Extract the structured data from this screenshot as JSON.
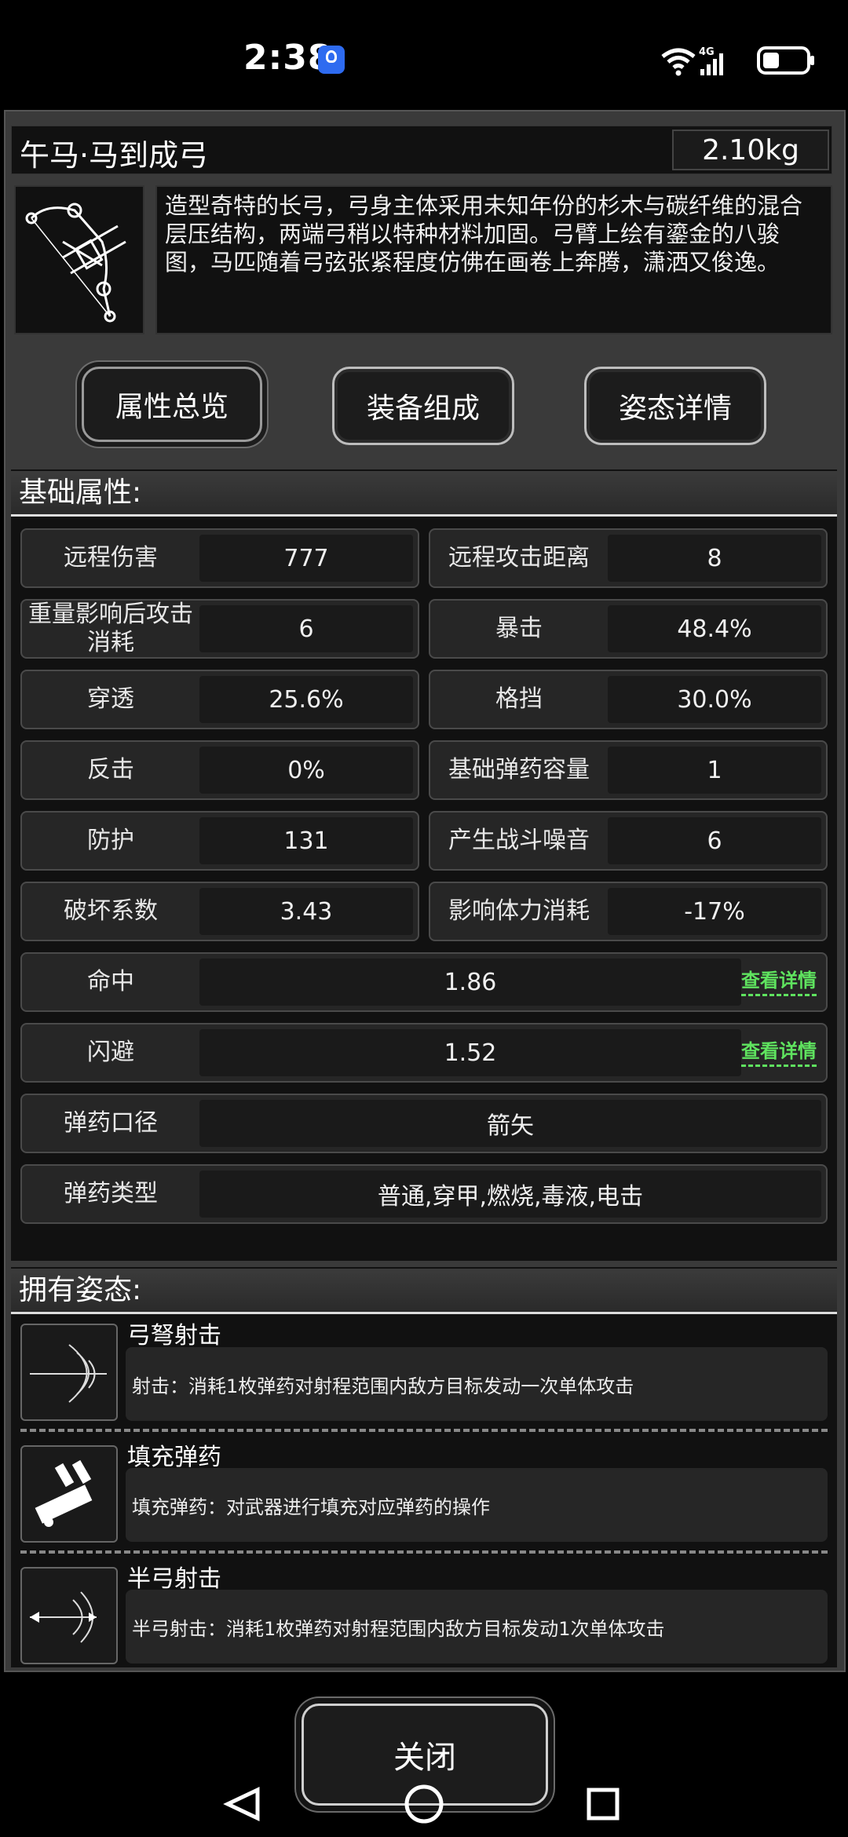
{
  "status": {
    "time": "2:38"
  },
  "item": {
    "name": "午马·马到成弓",
    "weight": "2.10kg",
    "description": "造型奇特的长弓，弓身主体采用未知年份的杉木与碳纤维的混合层压结构，两端弓稍以特种材料加固。弓臂上绘有鎏金的八骏图，马匹随着弓弦张紧程度仿佛在画卷上奔腾，潇洒又俊逸。"
  },
  "tabs": [
    "属性总览",
    "装备组成",
    "姿态详情"
  ],
  "basic": {
    "title": "基础属性:",
    "pairs": [
      [
        {
          "label": "远程伤害",
          "value": "777"
        },
        {
          "label": "远程攻击距离",
          "value": "8"
        }
      ],
      [
        {
          "label": "重量影响后攻击消耗",
          "value": "6"
        },
        {
          "label": "暴击",
          "value": "48.4%"
        }
      ],
      [
        {
          "label": "穿透",
          "value": "25.6%"
        },
        {
          "label": "格挡",
          "value": "30.0%"
        }
      ],
      [
        {
          "label": "反击",
          "value": "0%"
        },
        {
          "label": "基础弹药容量",
          "value": "1"
        }
      ],
      [
        {
          "label": "防护",
          "value": "131"
        },
        {
          "label": "产生战斗噪音",
          "value": "6"
        }
      ],
      [
        {
          "label": "破坏系数",
          "value": "3.43"
        },
        {
          "label": "影响体力消耗",
          "value": "-17%"
        }
      ]
    ],
    "hit": {
      "label": "命中",
      "value": "1.86",
      "link": "查看详情"
    },
    "dodge": {
      "label": "闪避",
      "value": "1.52",
      "link": "查看详情"
    },
    "caliber": {
      "label": "弹药口径",
      "value": "箭矢"
    },
    "ammo_types": {
      "label": "弹药类型",
      "value": "普通,穿甲,燃烧,毒液,电击"
    }
  },
  "stances": {
    "title": "拥有姿态:",
    "items": [
      {
        "name": "弓弩射击",
        "desc": "射击：消耗1枚弹药对射程范围内敌方目标发动一次单体攻击",
        "icon": "bow-shot-icon"
      },
      {
        "name": "填充弹药",
        "desc": "填充弹药：对武器进行填充对应弹药的操作",
        "icon": "reload-ammo-icon"
      },
      {
        "name": "半弓射击",
        "desc": "半弓射击：消耗1枚弹药对射程范围内敌方目标发动1次单体攻击",
        "icon": "half-bow-shot-icon"
      }
    ]
  },
  "close_label": "关闭"
}
